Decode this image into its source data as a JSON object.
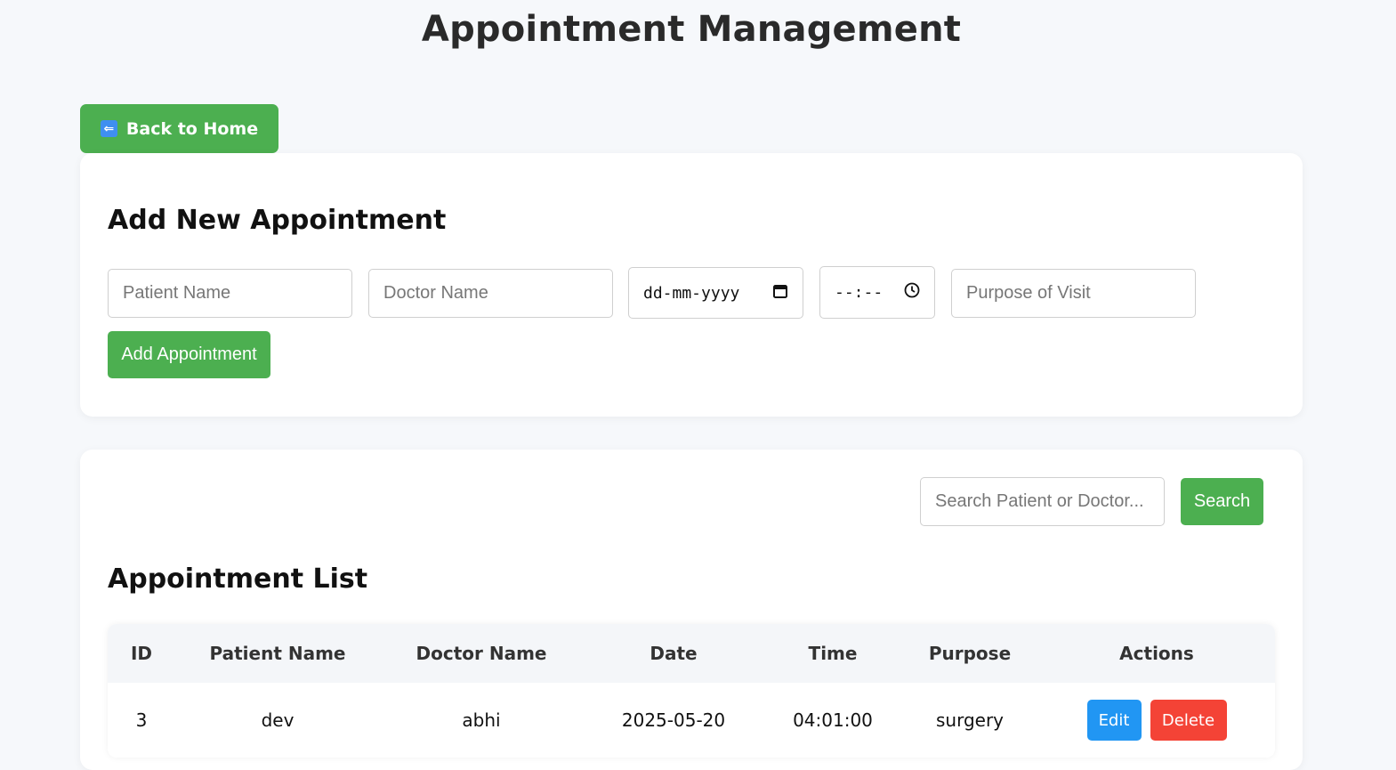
{
  "header": {
    "title": "Appointment Management"
  },
  "nav": {
    "back_label": "Back to Home",
    "back_icon": "left-arrow-icon"
  },
  "add_form": {
    "title": "Add New Appointment",
    "patient_placeholder": "Patient Name",
    "doctor_placeholder": "Doctor Name",
    "date_placeholder": "dd-mm-yyyy",
    "time_placeholder": "--:--",
    "purpose_placeholder": "Purpose of Visit",
    "submit_label": "Add Appointment"
  },
  "search": {
    "placeholder": "Search Patient or Doctor...",
    "button_label": "Search"
  },
  "list": {
    "title": "Appointment List",
    "columns": [
      "ID",
      "Patient Name",
      "Doctor Name",
      "Date",
      "Time",
      "Purpose",
      "Actions"
    ],
    "rows": [
      {
        "id": "3",
        "patient": "dev",
        "doctor": "abhi",
        "date": "2025-05-20",
        "time": "04:01:00",
        "purpose": "surgery",
        "edit_label": "Edit",
        "delete_label": "Delete"
      }
    ]
  },
  "colors": {
    "primary": "#4caf50",
    "edit": "#2196f3",
    "delete": "#f44336",
    "background": "#f6f8fb"
  }
}
